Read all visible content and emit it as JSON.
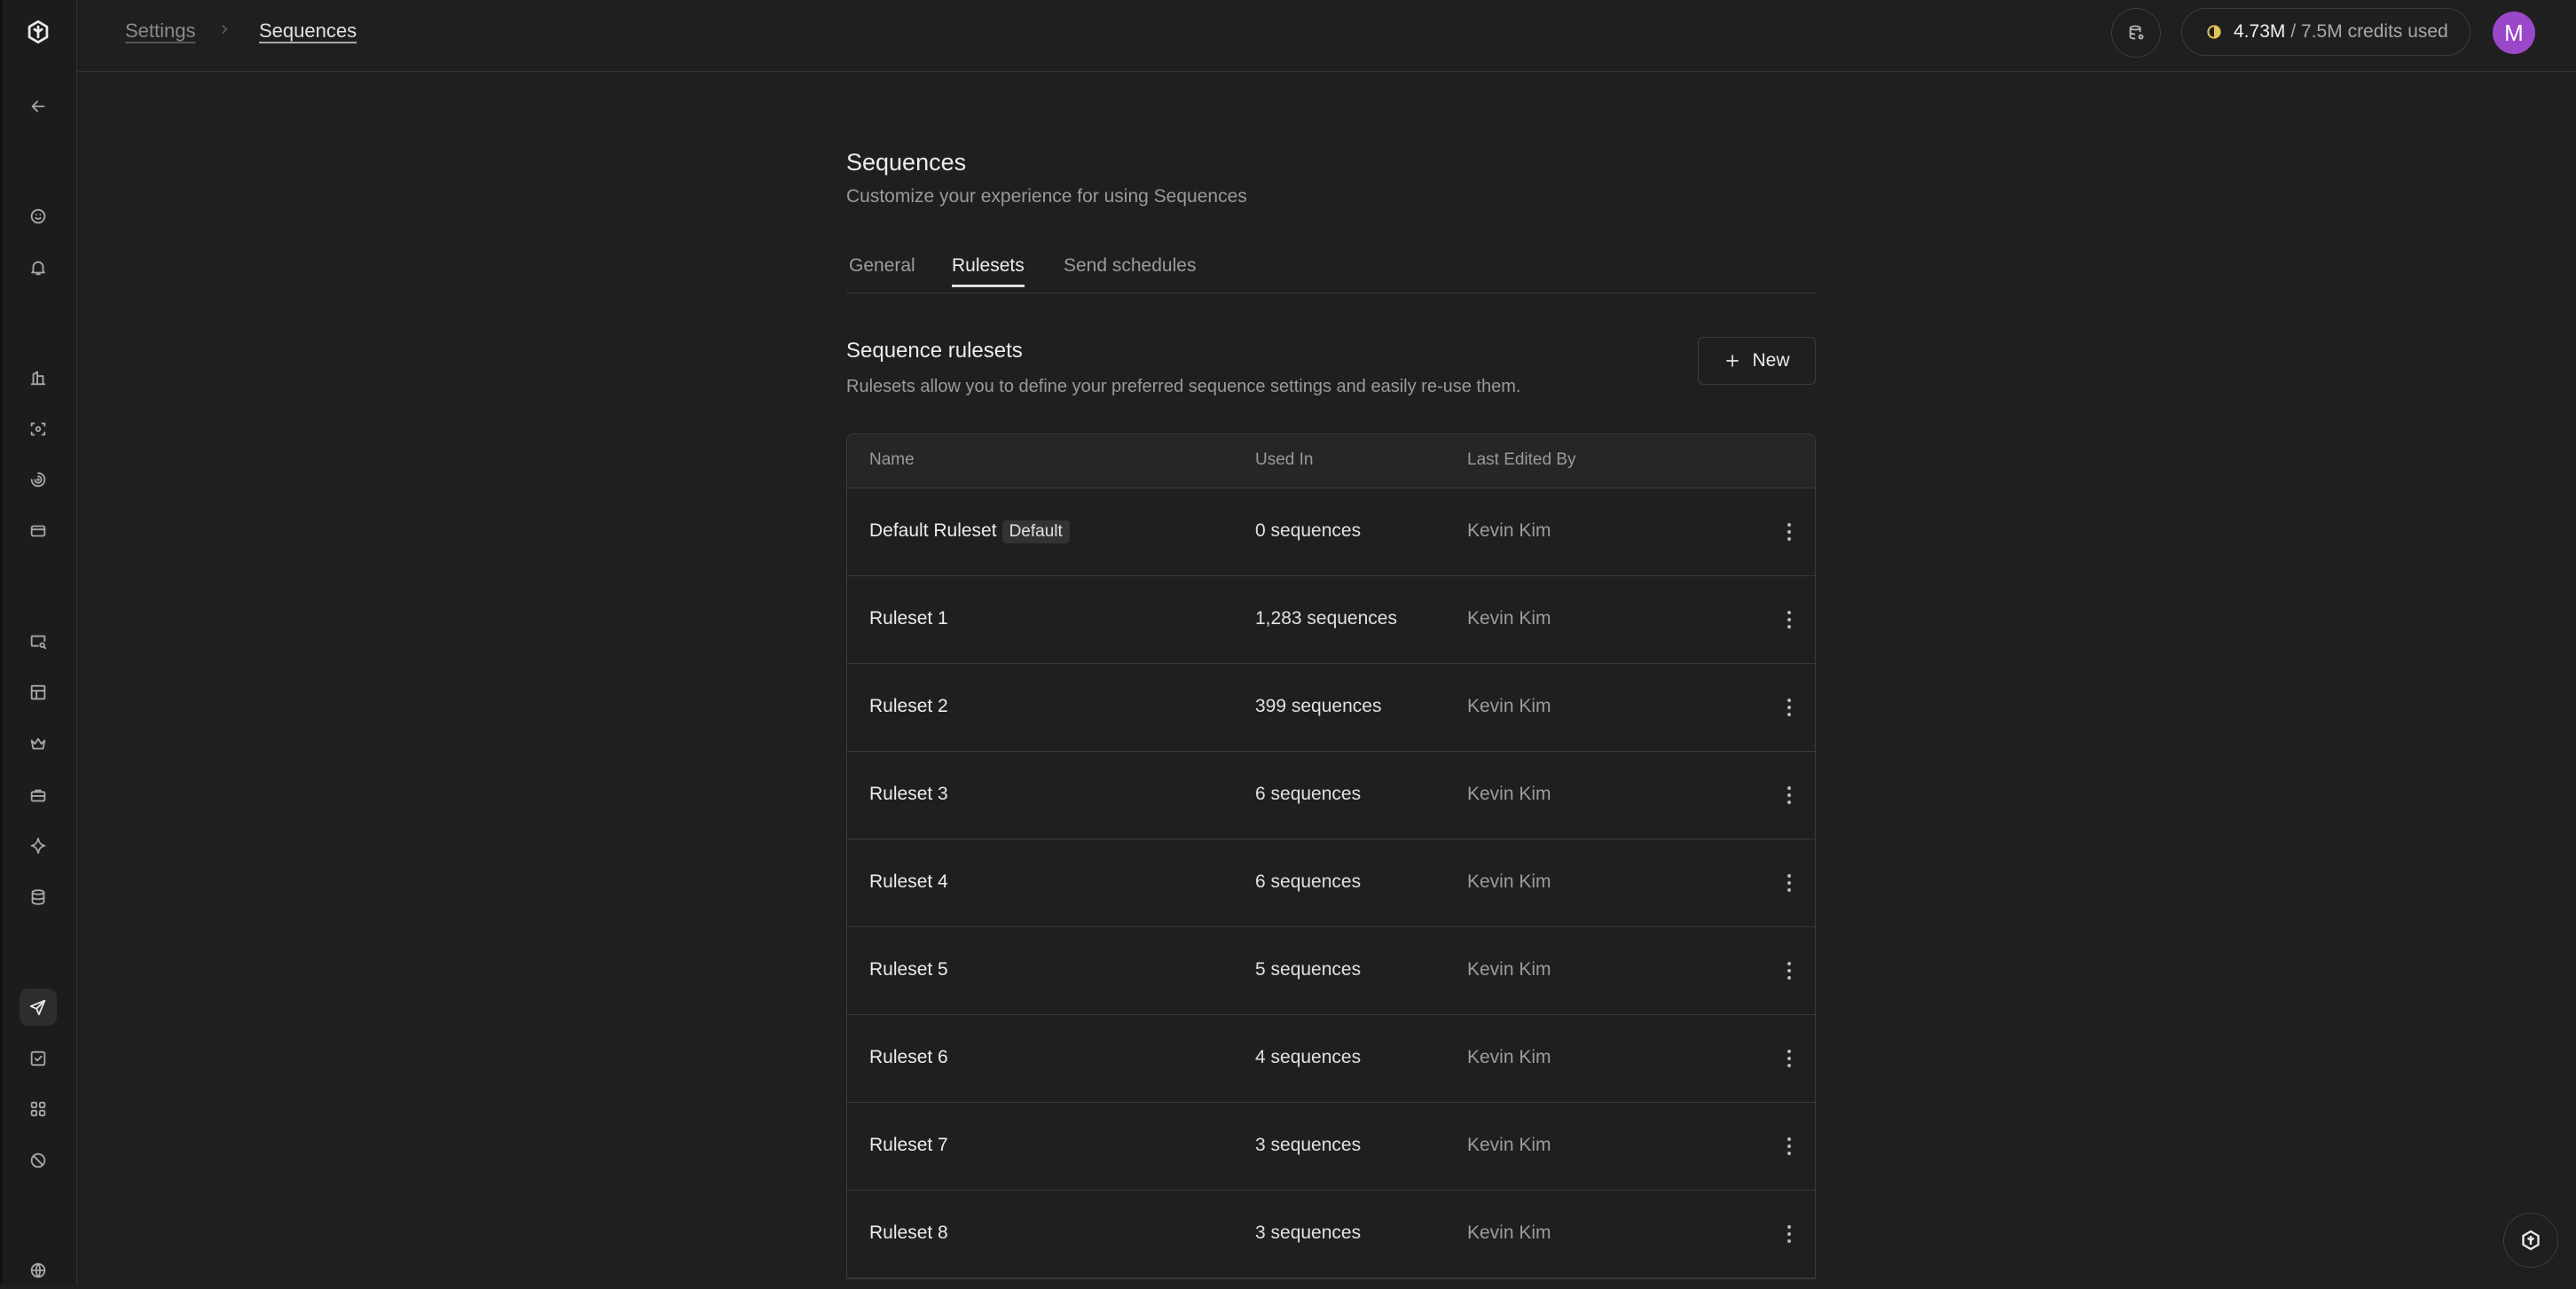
{
  "breadcrumb": {
    "parent": "Settings",
    "current": "Sequences"
  },
  "header": {
    "credits_used": "4.73M",
    "credits_total": "/ 7.5M credits used",
    "avatar_initial": "M",
    "avatar_color": "#9b47c9"
  },
  "page": {
    "title": "Sequences",
    "subtitle": "Customize your experience for using Sequences"
  },
  "tabs": [
    {
      "label": "General",
      "active": false
    },
    {
      "label": "Rulesets",
      "active": true
    },
    {
      "label": "Send schedules",
      "active": false
    }
  ],
  "section": {
    "title": "Sequence rulesets",
    "subtitle": "Rulesets allow you to define your preferred sequence settings and easily re-use them.",
    "new_label": "New"
  },
  "table": {
    "columns": [
      "Name",
      "Used In",
      "Last Edited By"
    ],
    "rows": [
      {
        "name": "Default Ruleset",
        "badge": "Default",
        "used_in": "0 sequences",
        "edited_by": "Kevin Kim"
      },
      {
        "name": "Ruleset 1",
        "used_in": "1,283 sequences",
        "edited_by": "Kevin Kim"
      },
      {
        "name": "Ruleset 2",
        "used_in": "399 sequences",
        "edited_by": "Kevin Kim"
      },
      {
        "name": "Ruleset 3",
        "used_in": "6 sequences",
        "edited_by": "Kevin Kim"
      },
      {
        "name": "Ruleset 4",
        "used_in": "6 sequences",
        "edited_by": "Kevin Kim"
      },
      {
        "name": "Ruleset 5",
        "used_in": "5 sequences",
        "edited_by": "Kevin Kim"
      },
      {
        "name": "Ruleset 6",
        "used_in": "4 sequences",
        "edited_by": "Kevin Kim"
      },
      {
        "name": "Ruleset 7",
        "used_in": "3 sequences",
        "edited_by": "Kevin Kim"
      },
      {
        "name": "Ruleset 8",
        "used_in": "3 sequences",
        "edited_by": "Kevin Kim"
      }
    ]
  },
  "sidebar_icons": [
    "logo-icon",
    "back-arrow-icon",
    "smiley-icon",
    "bell-icon",
    "building-icon",
    "scan-icon",
    "target-icon",
    "card-icon",
    "search-screen-icon",
    "grid-table-icon",
    "crown-icon",
    "briefcase-icon",
    "sparkle-icon",
    "database-icon",
    "send-icon",
    "checkbox-icon",
    "apps-icon",
    "block-icon",
    "globe-icon"
  ],
  "colors": {
    "background": "#1f1f1f",
    "border": "#3a3a3a",
    "muted_text": "#9a9a9a"
  }
}
